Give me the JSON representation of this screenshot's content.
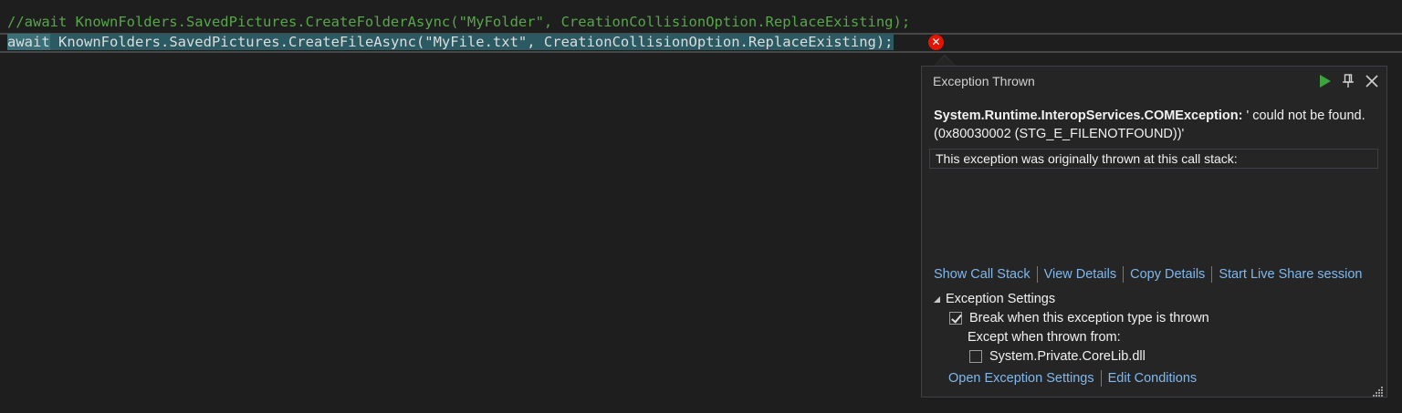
{
  "editor": {
    "line1": "//await KnownFolders.SavedPictures.CreateFolderAsync(\"MyFolder\", CreationCollisionOption.ReplaceExisting);",
    "line2_await": "await",
    "line2_rest": " KnownFolders.SavedPictures.CreateFileAsync(\"MyFile.txt\", CreationCollisionOption.ReplaceExisting);",
    "error_glyph": "✕"
  },
  "popup": {
    "title": "Exception Thrown",
    "exception_type": "System.Runtime.InteropServices.COMException:",
    "exception_message": " ' could not be found. (0x80030002 (STG_E_FILENOTFOUND))'",
    "callstack_header": "This exception was originally thrown at this call stack:",
    "actions": {
      "show_call_stack": "Show Call Stack",
      "view_details": "View Details",
      "copy_details": "Copy Details",
      "live_share": "Start Live Share session"
    },
    "settings": {
      "header": "Exception Settings",
      "break_label": "Break when this exception type is thrown",
      "break_checked": true,
      "except_label": "Except when thrown from:",
      "corelib_label": "System.Private.CoreLib.dll",
      "corelib_checked": false,
      "open_settings": "Open Exception Settings",
      "edit_conditions": "Edit Conditions"
    },
    "icons": {
      "play": "play-icon",
      "pin": "pin-icon",
      "close": "close-icon",
      "expand": "triangle-expanded-icon",
      "grip": "resize-grip-icon"
    },
    "colors": {
      "link": "#7fb8ee",
      "play": "#3ea33e",
      "error": "#e51400"
    }
  }
}
